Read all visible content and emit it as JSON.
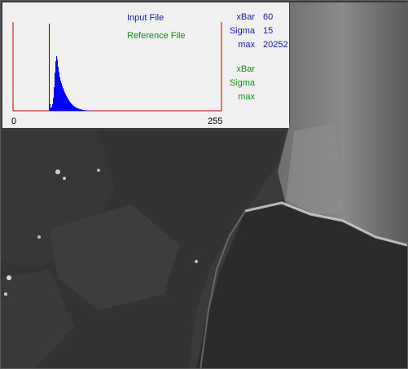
{
  "window": {
    "title": ""
  },
  "histogram": {
    "legend": {
      "input_label": "Input File",
      "reference_label": "Reference File"
    },
    "colors": {
      "input": "#0000ff",
      "reference": "#008000",
      "axes": "#cc0000",
      "panel": "#f0f0f0"
    },
    "x_axis": {
      "min_label": "0",
      "max_label": "255",
      "range": [
        0,
        255
      ]
    },
    "input_stats": [
      {
        "label": "xBar",
        "value": "60"
      },
      {
        "label": "Sigma",
        "value": "15"
      },
      {
        "label": "max",
        "value": "20252"
      }
    ],
    "reference_stats": [
      {
        "label": "xBar",
        "value": ""
      },
      {
        "label": "Sigma",
        "value": ""
      },
      {
        "label": "max",
        "value": ""
      }
    ]
  },
  "chart_data": {
    "type": "area",
    "x": [
      40,
      41,
      42,
      43,
      44,
      45,
      46,
      47,
      48,
      49,
      50,
      51,
      52,
      53,
      54,
      55,
      56,
      57,
      58,
      59,
      60,
      61,
      62,
      63,
      64,
      65,
      66,
      67,
      68,
      69,
      70,
      71,
      72,
      73,
      74,
      75,
      76,
      77,
      78,
      79,
      80,
      81,
      82,
      83,
      84,
      85,
      86,
      87,
      88,
      89,
      90,
      91,
      92,
      93,
      94,
      95,
      96,
      97,
      98,
      99,
      100
    ],
    "series": [
      {
        "name": "Input File",
        "values": [
          0,
          0,
          0,
          0,
          20252,
          1500,
          600,
          900,
          1500,
          3000,
          5500,
          8800,
          11500,
          12700,
          11900,
          10200,
          9000,
          7800,
          7000,
          6400,
          5800,
          5300,
          4800,
          4300,
          3900,
          3500,
          3100,
          2800,
          2500,
          2200,
          1950,
          1700,
          1500,
          1300,
          1150,
          1000,
          880,
          760,
          660,
          580,
          500,
          430,
          370,
          320,
          270,
          230,
          190,
          160,
          130,
          110,
          90,
          70,
          55,
          45,
          35,
          25,
          18,
          12,
          8,
          4,
          0
        ]
      },
      {
        "name": "Reference File",
        "values": []
      }
    ],
    "xlim": [
      0,
      255
    ],
    "ylim": [
      0,
      20252
    ],
    "grid": false
  }
}
